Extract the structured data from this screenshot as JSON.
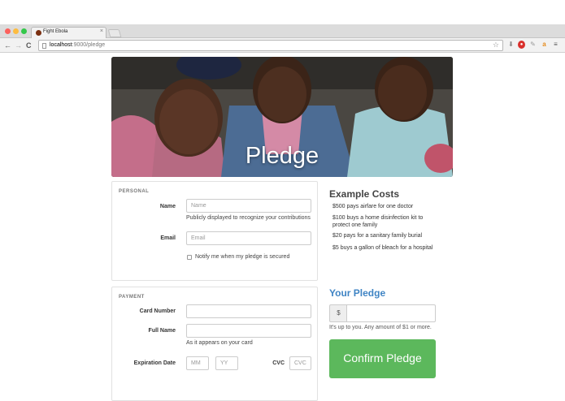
{
  "browser": {
    "tab_title": "Fight Ebola",
    "tab_close": "×",
    "url_host": "localhost",
    "url_path": ":9000/pledge",
    "nav": {
      "back": "←",
      "forward": "→",
      "reload": "C"
    },
    "star": "☆",
    "menu": "≡",
    "colors": {
      "close": "#fc615d",
      "minimize": "#fdbc40",
      "maximize": "#34c84a"
    }
  },
  "hero": {
    "title": "Pledge"
  },
  "personal": {
    "section": "PERSONAL",
    "name_label": "Name",
    "name_placeholder": "Name",
    "name_help": "Publicly displayed to recognize your contributions",
    "email_label": "Email",
    "email_placeholder": "Email",
    "notify_label": "Notify me when my pledge is secured"
  },
  "costs": {
    "title": "Example Costs",
    "items": [
      "$500 pays airfare for one doctor",
      "$100 buys a home disinfection kit to protect one family",
      "$20 pays for a sanitary family burial",
      "$5 buys a gallon of bleach for a hospital"
    ]
  },
  "payment": {
    "section": "PAYMENT",
    "card_label": "Card Number",
    "fullname_label": "Full Name",
    "fullname_help": "As it appears on your card",
    "exp_label": "Expiration Date",
    "mm_placeholder": "MM",
    "yy_placeholder": "YY",
    "cvc_label": "CVC",
    "cvc_placeholder": "CVC"
  },
  "pledge": {
    "title": "Your Pledge",
    "currency": "$",
    "help": "It's up to you. Any amount of $1 or more.",
    "confirm": "Confirm Pledge",
    "accent": "#3f84c4",
    "button_color": "#5cb85c"
  }
}
